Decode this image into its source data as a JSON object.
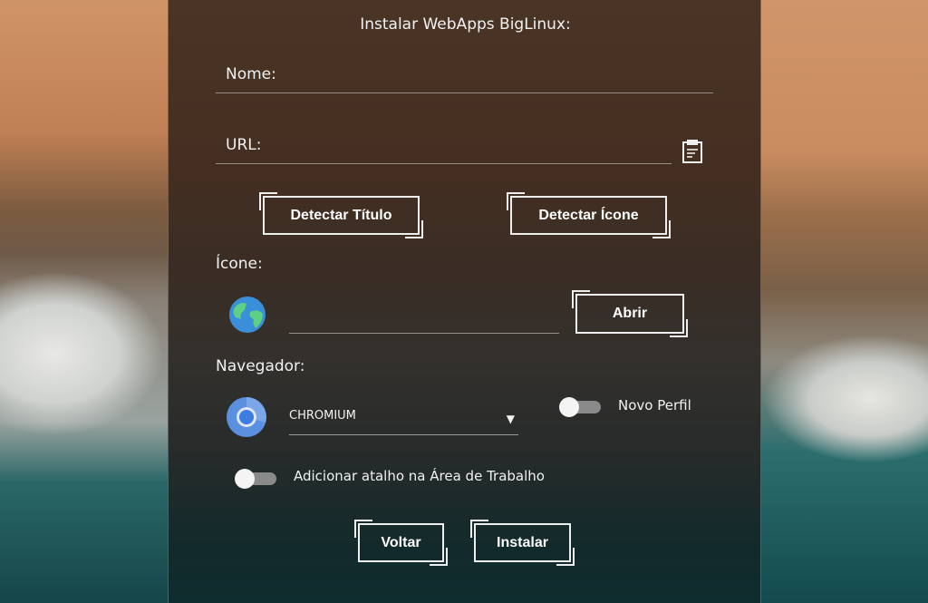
{
  "title": "Instalar WebApps BigLinux:",
  "fields": {
    "name_label": "Nome:",
    "name_value": "",
    "url_label": "URL:",
    "url_value": "",
    "icon_label": "Ícone:",
    "icon_path": "",
    "browser_label": "Navegador:"
  },
  "buttons": {
    "detect_title": "Detectar Título",
    "detect_icon": "Detectar Ícone",
    "open": "Abrir",
    "back": "Voltar",
    "install": "Instalar"
  },
  "browser": {
    "selected": "CHROMIUM"
  },
  "toggles": {
    "new_profile": {
      "label": "Novo Perfil",
      "on": false
    },
    "desktop_shortcut": {
      "label": "Adicionar atalho na Área de Trabalho",
      "on": false
    }
  },
  "icons": {
    "clipboard": "clipboard-icon",
    "globe": "globe-icon",
    "chromium": "chromium-icon",
    "dropdown": "triangle-down"
  }
}
